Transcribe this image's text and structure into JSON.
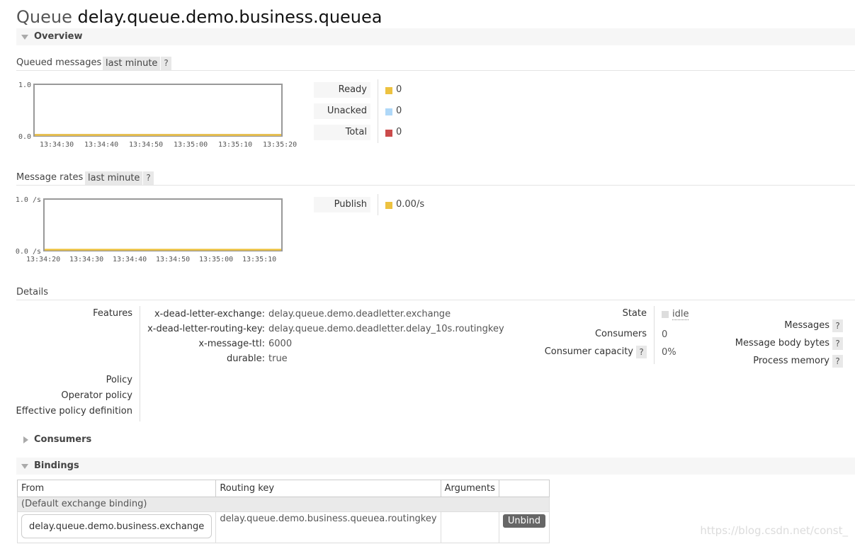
{
  "header": {
    "prefix": "Queue",
    "name": "delay.queue.demo.business.queuea"
  },
  "overview": {
    "label": "Overview"
  },
  "queued_messages": {
    "title": "Queued messages",
    "range": "last minute",
    "help": "?",
    "legend": [
      {
        "label": "Ready",
        "value": "0",
        "color": "#edc240"
      },
      {
        "label": "Unacked",
        "value": "0",
        "color": "#afd8f8"
      },
      {
        "label": "Total",
        "value": "0",
        "color": "#cb4b4b"
      }
    ]
  },
  "message_rates": {
    "title": "Message rates",
    "range": "last minute",
    "help": "?",
    "legend": [
      {
        "label": "Publish",
        "value": "0.00/s",
        "color": "#edc240"
      }
    ]
  },
  "chart_data": [
    {
      "type": "line",
      "y_tick_labels": [
        "1.0",
        "0.0"
      ],
      "x_tick_labels": [
        "13:34:30",
        "13:34:40",
        "13:34:50",
        "13:35:00",
        "13:35:10",
        "13:35:20"
      ],
      "ylim": [
        0,
        1
      ],
      "series": [
        {
          "name": "Ready",
          "values": [
            0,
            0,
            0,
            0,
            0,
            0
          ],
          "color": "#edc240"
        },
        {
          "name": "Unacked",
          "values": [
            0,
            0,
            0,
            0,
            0,
            0
          ],
          "color": "#afd8f8"
        },
        {
          "name": "Total",
          "values": [
            0,
            0,
            0,
            0,
            0,
            0
          ],
          "color": "#cb4b4b"
        }
      ]
    },
    {
      "type": "line",
      "y_tick_labels": [
        "1.0 /s",
        "0.0 /s"
      ],
      "x_tick_labels": [
        "13:34:20",
        "13:34:30",
        "13:34:40",
        "13:34:50",
        "13:35:00",
        "13:35:10"
      ],
      "ylim": [
        0,
        1
      ],
      "series": [
        {
          "name": "Publish",
          "values": [
            0,
            0,
            0,
            0,
            0,
            0
          ],
          "color": "#edc240"
        }
      ]
    }
  ],
  "details": {
    "title": "Details",
    "features_label": "Features",
    "features": [
      {
        "key": "x-dead-letter-exchange:",
        "value": "delay.queue.demo.deadletter.exchange"
      },
      {
        "key": "x-dead-letter-routing-key:",
        "value": "delay.queue.demo.deadletter.delay_10s.routingkey"
      },
      {
        "key": "x-message-ttl:",
        "value": "6000"
      },
      {
        "key": "durable:",
        "value": "true"
      }
    ],
    "policy_label": "Policy",
    "operator_policy_label": "Operator policy",
    "effective_policy_label": "Effective policy definition",
    "state_label": "State",
    "state_value": "idle",
    "consumers_label": "Consumers",
    "consumers_value": "0",
    "consumer_capacity_label": "Consumer capacity",
    "consumer_capacity_value": "0%",
    "messages_label": "Messages",
    "message_body_bytes_label": "Message body bytes",
    "process_memory_label": "Process memory",
    "help": "?"
  },
  "consumers_section": {
    "label": "Consumers"
  },
  "bindings": {
    "label": "Bindings",
    "columns": [
      "From",
      "Routing key",
      "Arguments",
      ""
    ],
    "default_row": "(Default exchange binding)",
    "rows": [
      {
        "from": "delay.queue.demo.business.exchange",
        "routing_key": "delay.queue.demo.business.queuea.routingkey",
        "arguments": "",
        "action": "Unbind"
      }
    ]
  },
  "watermark": "https://blog.csdn.net/const_"
}
